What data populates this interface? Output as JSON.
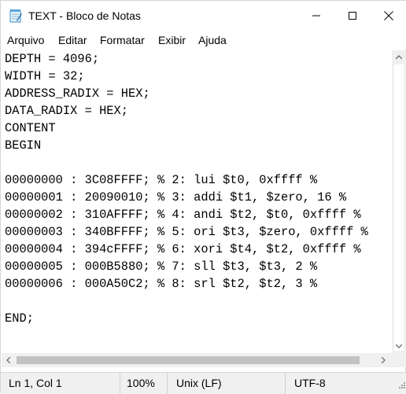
{
  "window": {
    "title": "TEXT - Bloco de Notas"
  },
  "icons": {
    "app": "notepad-icon",
    "minimize": "minimize-icon",
    "maximize": "maximize-icon",
    "close": "close-icon"
  },
  "menu": {
    "items": [
      "Arquivo",
      "Editar",
      "Formatar",
      "Exibir",
      "Ajuda"
    ]
  },
  "editor": {
    "content": "DEPTH = 4096;\nWIDTH = 32;\nADDRESS_RADIX = HEX;\nDATA_RADIX = HEX;\nCONTENT\nBEGIN\n\n00000000 : 3C08FFFF; % 2: lui $t0, 0xffff %\n00000001 : 20090010; % 3: addi $t1, $zero, 16 %\n00000002 : 310AFFFF; % 4: andi $t2, $t0, 0xffff %\n00000003 : 340BFFFF; % 5: ori $t3, $zero, 0xffff %\n00000004 : 394cFFFF; % 6: xori $t4, $t2, 0xffff %\n00000005 : 000B5880; % 7: sll $t3, $t3, 2 %\n00000006 : 000A50C2; % 8: srl $t2, $t2, 3 %\n\nEND;"
  },
  "statusbar": {
    "position": "Ln 1, Col 1",
    "zoom": "100%",
    "line_ending": "Unix (LF)",
    "encoding": "UTF-8"
  }
}
